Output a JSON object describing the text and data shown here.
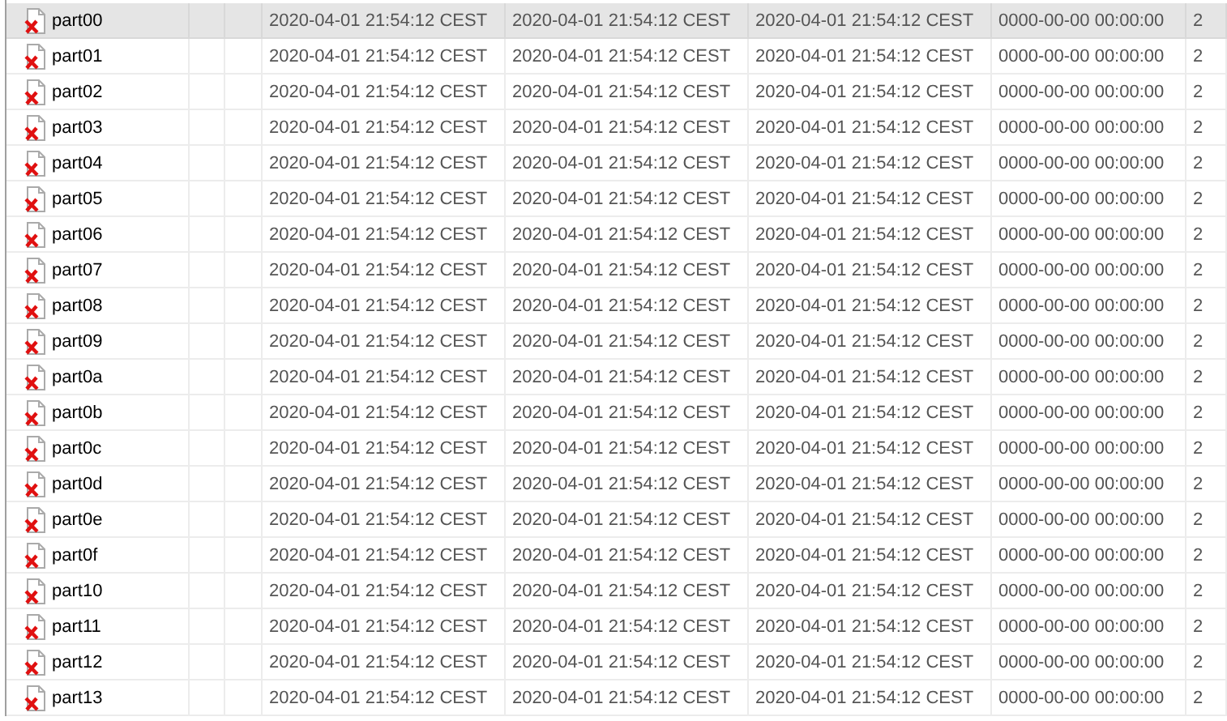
{
  "table": {
    "rows": [
      {
        "name": "part00",
        "selected": true,
        "cells": [
          "2020-04-01 21:54:12 CEST",
          "2020-04-01 21:54:12 CEST",
          "2020-04-01 21:54:12 CEST",
          "0000-00-00 00:00:00",
          "2"
        ]
      },
      {
        "name": "part01",
        "selected": false,
        "cells": [
          "2020-04-01 21:54:12 CEST",
          "2020-04-01 21:54:12 CEST",
          "2020-04-01 21:54:12 CEST",
          "0000-00-00 00:00:00",
          "2"
        ]
      },
      {
        "name": "part02",
        "selected": false,
        "cells": [
          "2020-04-01 21:54:12 CEST",
          "2020-04-01 21:54:12 CEST",
          "2020-04-01 21:54:12 CEST",
          "0000-00-00 00:00:00",
          "2"
        ]
      },
      {
        "name": "part03",
        "selected": false,
        "cells": [
          "2020-04-01 21:54:12 CEST",
          "2020-04-01 21:54:12 CEST",
          "2020-04-01 21:54:12 CEST",
          "0000-00-00 00:00:00",
          "2"
        ]
      },
      {
        "name": "part04",
        "selected": false,
        "cells": [
          "2020-04-01 21:54:12 CEST",
          "2020-04-01 21:54:12 CEST",
          "2020-04-01 21:54:12 CEST",
          "0000-00-00 00:00:00",
          "2"
        ]
      },
      {
        "name": "part05",
        "selected": false,
        "cells": [
          "2020-04-01 21:54:12 CEST",
          "2020-04-01 21:54:12 CEST",
          "2020-04-01 21:54:12 CEST",
          "0000-00-00 00:00:00",
          "2"
        ]
      },
      {
        "name": "part06",
        "selected": false,
        "cells": [
          "2020-04-01 21:54:12 CEST",
          "2020-04-01 21:54:12 CEST",
          "2020-04-01 21:54:12 CEST",
          "0000-00-00 00:00:00",
          "2"
        ]
      },
      {
        "name": "part07",
        "selected": false,
        "cells": [
          "2020-04-01 21:54:12 CEST",
          "2020-04-01 21:54:12 CEST",
          "2020-04-01 21:54:12 CEST",
          "0000-00-00 00:00:00",
          "2"
        ]
      },
      {
        "name": "part08",
        "selected": false,
        "cells": [
          "2020-04-01 21:54:12 CEST",
          "2020-04-01 21:54:12 CEST",
          "2020-04-01 21:54:12 CEST",
          "0000-00-00 00:00:00",
          "2"
        ]
      },
      {
        "name": "part09",
        "selected": false,
        "cells": [
          "2020-04-01 21:54:12 CEST",
          "2020-04-01 21:54:12 CEST",
          "2020-04-01 21:54:12 CEST",
          "0000-00-00 00:00:00",
          "2"
        ]
      },
      {
        "name": "part0a",
        "selected": false,
        "cells": [
          "2020-04-01 21:54:12 CEST",
          "2020-04-01 21:54:12 CEST",
          "2020-04-01 21:54:12 CEST",
          "0000-00-00 00:00:00",
          "2"
        ]
      },
      {
        "name": "part0b",
        "selected": false,
        "cells": [
          "2020-04-01 21:54:12 CEST",
          "2020-04-01 21:54:12 CEST",
          "2020-04-01 21:54:12 CEST",
          "0000-00-00 00:00:00",
          "2"
        ]
      },
      {
        "name": "part0c",
        "selected": false,
        "cells": [
          "2020-04-01 21:54:12 CEST",
          "2020-04-01 21:54:12 CEST",
          "2020-04-01 21:54:12 CEST",
          "0000-00-00 00:00:00",
          "2"
        ]
      },
      {
        "name": "part0d",
        "selected": false,
        "cells": [
          "2020-04-01 21:54:12 CEST",
          "2020-04-01 21:54:12 CEST",
          "2020-04-01 21:54:12 CEST",
          "0000-00-00 00:00:00",
          "2"
        ]
      },
      {
        "name": "part0e",
        "selected": false,
        "cells": [
          "2020-04-01 21:54:12 CEST",
          "2020-04-01 21:54:12 CEST",
          "2020-04-01 21:54:12 CEST",
          "0000-00-00 00:00:00",
          "2"
        ]
      },
      {
        "name": "part0f",
        "selected": false,
        "cells": [
          "2020-04-01 21:54:12 CEST",
          "2020-04-01 21:54:12 CEST",
          "2020-04-01 21:54:12 CEST",
          "0000-00-00 00:00:00",
          "2"
        ]
      },
      {
        "name": "part10",
        "selected": false,
        "cells": [
          "2020-04-01 21:54:12 CEST",
          "2020-04-01 21:54:12 CEST",
          "2020-04-01 21:54:12 CEST",
          "0000-00-00 00:00:00",
          "2"
        ]
      },
      {
        "name": "part11",
        "selected": false,
        "cells": [
          "2020-04-01 21:54:12 CEST",
          "2020-04-01 21:54:12 CEST",
          "2020-04-01 21:54:12 CEST",
          "0000-00-00 00:00:00",
          "2"
        ]
      },
      {
        "name": "part12",
        "selected": false,
        "cells": [
          "2020-04-01 21:54:12 CEST",
          "2020-04-01 21:54:12 CEST",
          "2020-04-01 21:54:12 CEST",
          "0000-00-00 00:00:00",
          "2"
        ]
      },
      {
        "name": "part13",
        "selected": false,
        "cells": [
          "2020-04-01 21:54:12 CEST",
          "2020-04-01 21:54:12 CEST",
          "2020-04-01 21:54:12 CEST",
          "0000-00-00 00:00:00",
          "2"
        ]
      }
    ]
  }
}
